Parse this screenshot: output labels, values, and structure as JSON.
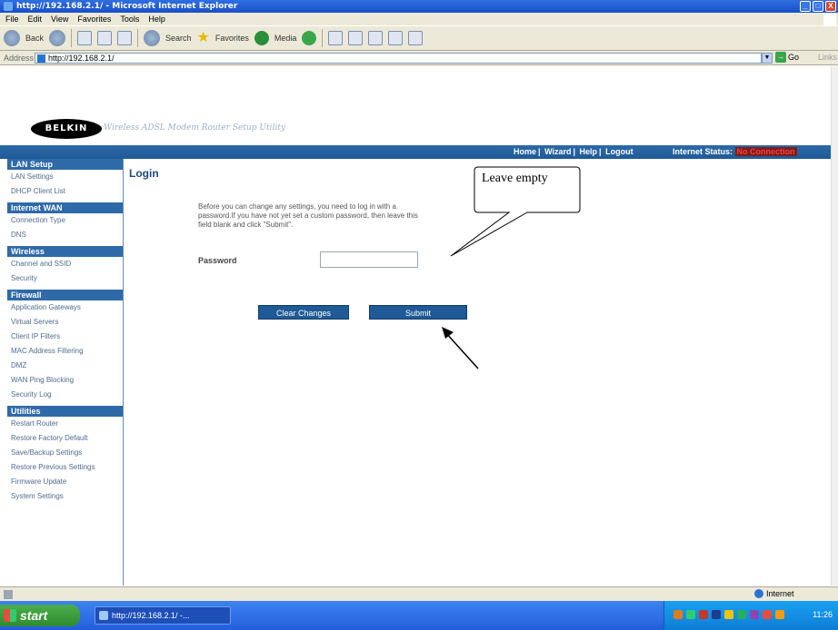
{
  "window": {
    "title": "http://192.168.2.1/ - Microsoft Internet Explorer",
    "controls": [
      "_",
      "□",
      "X"
    ]
  },
  "menu": [
    "File",
    "Edit",
    "View",
    "Favorites",
    "Tools",
    "Help"
  ],
  "toolbar": {
    "back": "Back",
    "search": "Search",
    "favorites": "Favorites",
    "media": "Media"
  },
  "address": {
    "label": "Address",
    "value": "http://192.168.2.1/",
    "go": "Go",
    "links": "Links"
  },
  "router": {
    "logo": "BELKIN",
    "setup_title": "Wireless ADSL Modem Router Setup Utility",
    "nav": [
      "Home",
      "Wizard",
      "Help",
      "Logout"
    ],
    "status_label": "Internet Status:",
    "status_value": "No Connection"
  },
  "sidebar": [
    {
      "section": "LAN Setup",
      "items": [
        "LAN Settings",
        "DHCP Client List"
      ]
    },
    {
      "section": "Internet WAN",
      "items": [
        "Connection Type",
        "DNS"
      ]
    },
    {
      "section": "Wireless",
      "items": [
        "Channel and SSID",
        "Security"
      ]
    },
    {
      "section": "Firewall",
      "items": [
        "Application Gateways",
        "Virtual Servers",
        "Client IP Filters",
        "MAC Address Filtering",
        "DMZ",
        "WAN Ping Blocking",
        "Security Log"
      ]
    },
    {
      "section": "Utilities",
      "items": [
        "Restart Router",
        "Restore Factory Default",
        "Save/Backup Settings",
        "Restore Previous Settings",
        "Firmware Update",
        "System Settings"
      ]
    }
  ],
  "main": {
    "title": "Login",
    "description": "Before you can change any settings, you need to log in with a\npassword.If you have not yet set a custom password, then leave this\nfield blank and click \"Submit\".",
    "password_label": "Password",
    "clear_button": "Clear Changes",
    "submit_button": "Submit"
  },
  "annotation": {
    "callout": "Leave empty"
  },
  "status": {
    "zone": "Internet"
  },
  "taskbar": {
    "start": "start",
    "task": "http://192.168.2.1/ -...",
    "clock": "11:26"
  }
}
